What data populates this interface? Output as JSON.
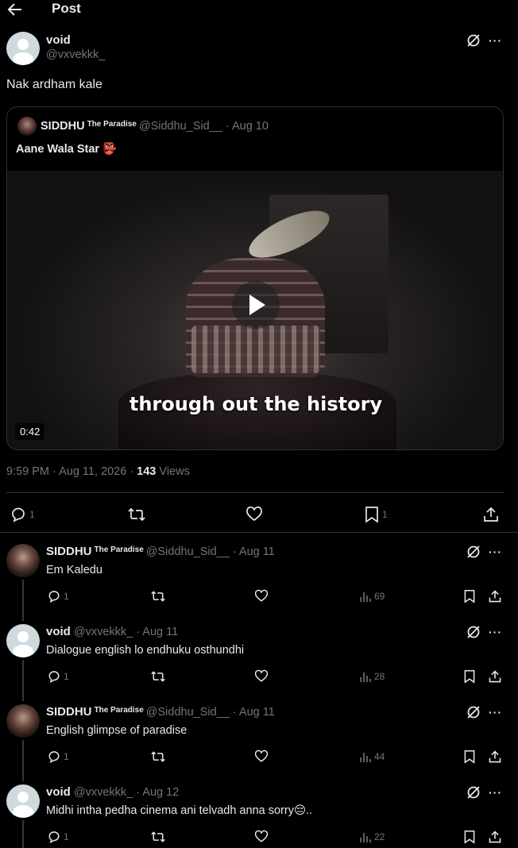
{
  "header": {
    "title": "Post"
  },
  "post": {
    "author_name": "void",
    "author_handle": "@vxvekkk_",
    "text": "Nak ardham kale",
    "quote": {
      "author_name": "SIDDHU",
      "author_badge": "The Paradise",
      "author_handle": "@Siddhu_Sid__",
      "date": "· Aug 10",
      "text": "Aane Wala Star 👺",
      "video_caption": "through out the history",
      "video_duration": "0:42"
    },
    "time": "9:59 PM · Aug 11, 2026 ·",
    "views_count": "143",
    "views_label": "Views",
    "actions": {
      "replies": "1",
      "bookmarks": "1"
    }
  },
  "replies": [
    {
      "author_name": "SIDDHU",
      "author_badge": "The Paradise",
      "author_handle": "@Siddhu_Sid__",
      "date": "· Aug 11",
      "text": "Em Kaledu",
      "replies": "1",
      "views": "69"
    },
    {
      "author_name": "void",
      "author_badge": "",
      "author_handle": "@vxvekkk_",
      "date": "· Aug 11",
      "text": "Dialogue english lo endhuku osthundhi",
      "replies": "1",
      "views": "28"
    },
    {
      "author_name": "SIDDHU",
      "author_badge": "The Paradise",
      "author_handle": "@Siddhu_Sid__",
      "date": "· Aug 11",
      "text": "English glimpse of paradise",
      "replies": "1",
      "views": "44"
    },
    {
      "author_name": "void",
      "author_badge": "",
      "author_handle": "@vxvekkk_",
      "date": "· Aug 12",
      "text": "Midhi intha pedha cinema ani telvadh anna sorry😔..",
      "replies": "1",
      "views": "22"
    }
  ],
  "icons": {
    "back": "arrow-left-icon",
    "grok": "grok-icon",
    "more": "more-icon",
    "reply": "reply-icon",
    "repost": "repost-icon",
    "like": "heart-icon",
    "bookmark": "bookmark-icon",
    "share": "share-icon",
    "views": "views-icon",
    "play": "play-icon"
  },
  "colors": {
    "background": "#000000",
    "text": "#e7e9ea",
    "muted": "#71767b",
    "border": "#2f3336"
  }
}
